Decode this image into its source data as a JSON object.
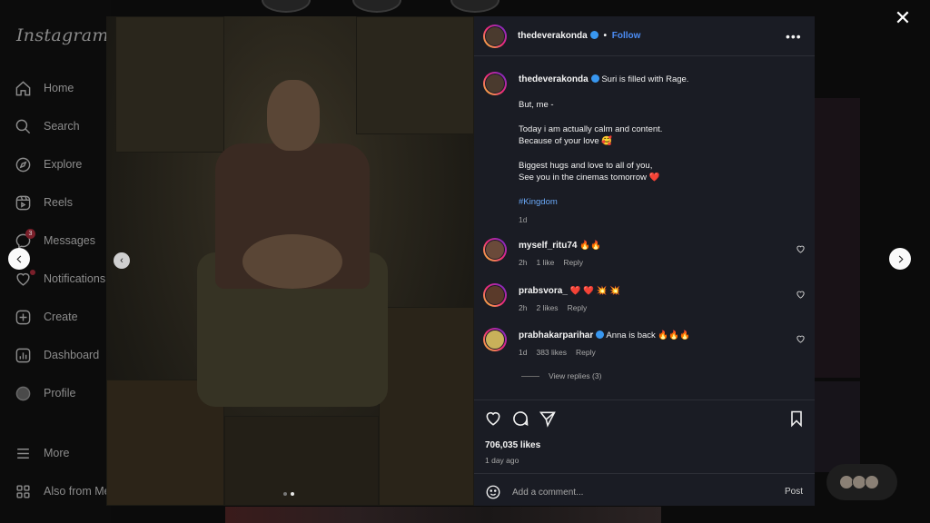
{
  "app": {
    "logo": "Instagram"
  },
  "sidebar": {
    "items": [
      {
        "label": "Home",
        "icon": "home-icon"
      },
      {
        "label": "Search",
        "icon": "search-icon"
      },
      {
        "label": "Explore",
        "icon": "compass-icon"
      },
      {
        "label": "Reels",
        "icon": "reels-icon"
      },
      {
        "label": "Messages",
        "icon": "messenger-icon",
        "badge": "3"
      },
      {
        "label": "Notifications",
        "icon": "heart-icon"
      },
      {
        "label": "Create",
        "icon": "plus-square-icon"
      },
      {
        "label": "Dashboard",
        "icon": "dashboard-icon"
      },
      {
        "label": "Profile",
        "icon": "profile-avatar-icon"
      },
      {
        "label": "More",
        "icon": "menu-icon"
      },
      {
        "label": "Also from Me",
        "icon": "grid-icon"
      }
    ]
  },
  "post": {
    "username": "thedeverakonda",
    "follow_label": "Follow",
    "separator": "•",
    "caption_lead": "Suri is filled with Rage.",
    "caption_lines": [
      "But, me -",
      "Today i am actually calm and content.",
      "Because of your love 🥰",
      "Biggest hugs and love to all of you,",
      "See you in the cinemas tomorrow ❤️"
    ],
    "hashtag": "#Kingdom",
    "caption_age": "1d",
    "likes": "706,035 likes",
    "posted": "1 day ago",
    "comment_placeholder": "Add a comment...",
    "post_button": "Post"
  },
  "comments": [
    {
      "username": "myself_ritu74",
      "text": "🔥🔥",
      "age": "2h",
      "likes": "1 like",
      "reply": "Reply"
    },
    {
      "username": "prabsvora_",
      "text": "❤️ ❤️ 💥 💥",
      "age": "2h",
      "likes": "2 likes",
      "reply": "Reply"
    },
    {
      "username": "prabhakarparihar",
      "text": "Anna is back 🔥🔥🔥",
      "age": "1d",
      "likes": "383 likes",
      "reply": "Reply",
      "view_replies": "View replies (3)"
    }
  ],
  "colors": {
    "panel_bg": "#1a1c24",
    "link": "#4c8df6",
    "verified": "#3897f0",
    "badge": "#7a1f2a"
  }
}
